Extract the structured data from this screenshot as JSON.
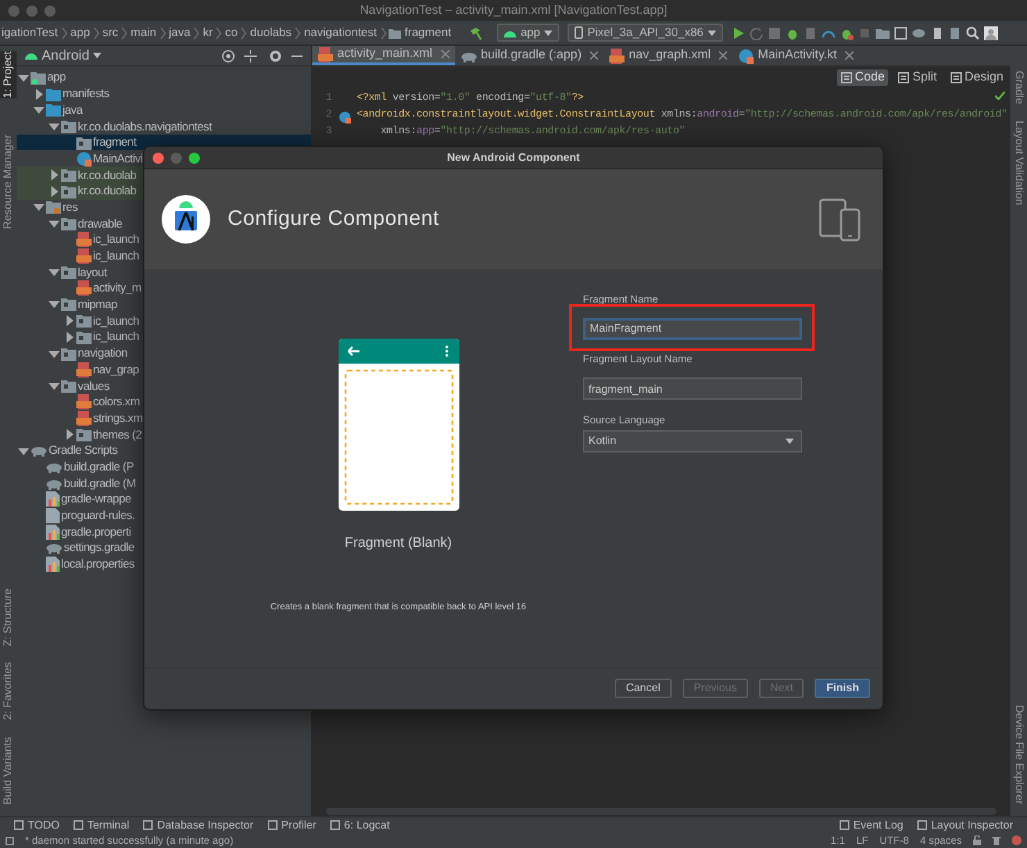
{
  "window": {
    "title": "NavigationTest – activity_main.xml [NavigationTest.app]"
  },
  "breadcrumbs": [
    "igationTest",
    "app",
    "src",
    "main",
    "java",
    "kr",
    "co",
    "duolabs",
    "navigationtest",
    "fragment"
  ],
  "run_config": "app",
  "device": "Pixel_3a_API_30_x86",
  "left_strip": {
    "top": [
      {
        "label": "1: Project",
        "selected": true
      },
      {
        "label": "Resource Manager",
        "selected": false
      }
    ],
    "bottom": [
      {
        "label": "Z: Structure",
        "selected": false
      },
      {
        "label": "2: Favorites",
        "selected": false
      },
      {
        "label": "Build Variants",
        "selected": false
      }
    ]
  },
  "project_panel": {
    "view": "Android",
    "tree": [
      {
        "label": "app",
        "kind": "module",
        "expanded": true,
        "selected": false,
        "children": [
          {
            "label": "manifests",
            "kind": "folder",
            "expanded": false,
            "selected": false
          },
          {
            "label": "java",
            "kind": "folder",
            "expanded": true,
            "selected": false,
            "children": [
              {
                "label": "kr.co.duolabs.navigationtest",
                "kind": "package",
                "expanded": true,
                "selected": false,
                "children": [
                  {
                    "label": "fragment",
                    "kind": "package",
                    "selected": true
                  },
                  {
                    "label": "MainActivi",
                    "kind": "kotlin",
                    "selected": false
                  }
                ]
              },
              {
                "label": "kr.co.duolab",
                "kind": "test_package",
                "expanded": false,
                "selected": false
              },
              {
                "label": "kr.co.duolab",
                "kind": "test_package",
                "expanded": false,
                "selected": false
              }
            ]
          },
          {
            "label": "res",
            "kind": "res_folder",
            "expanded": true,
            "selected": false,
            "children": [
              {
                "label": "drawable",
                "kind": "package",
                "expanded": true,
                "selected": false,
                "children": [
                  {
                    "label": "ic_launch",
                    "kind": "xml",
                    "selected": false
                  },
                  {
                    "label": "ic_launch",
                    "kind": "xml",
                    "selected": false
                  }
                ]
              },
              {
                "label": "layout",
                "kind": "package",
                "expanded": true,
                "selected": false,
                "children": [
                  {
                    "label": "activity_m",
                    "kind": "xml",
                    "selected": false
                  }
                ]
              },
              {
                "label": "mipmap",
                "kind": "package",
                "expanded": true,
                "selected": false,
                "children": [
                  {
                    "label": "ic_launch",
                    "kind": "package",
                    "expanded": false,
                    "selected": false
                  },
                  {
                    "label": "ic_launch",
                    "kind": "package",
                    "expanded": false,
                    "selected": false
                  }
                ]
              },
              {
                "label": "navigation",
                "kind": "package",
                "expanded": true,
                "selected": false,
                "children": [
                  {
                    "label": "nav_grap",
                    "kind": "xml",
                    "selected": false
                  }
                ]
              },
              {
                "label": "values",
                "kind": "package",
                "expanded": true,
                "selected": false,
                "children": [
                  {
                    "label": "colors.xm",
                    "kind": "xml",
                    "selected": false
                  },
                  {
                    "label": "strings.xm",
                    "kind": "xml",
                    "selected": false
                  },
                  {
                    "label": "themes (2",
                    "kind": "package",
                    "expanded": false,
                    "selected": false
                  }
                ]
              }
            ]
          }
        ]
      },
      {
        "label": "Gradle Scripts",
        "kind": "gradle",
        "expanded": true,
        "selected": false,
        "children": [
          {
            "label": "build.gradle (P",
            "kind": "gradle",
            "selected": false
          },
          {
            "label": "build.gradle (M",
            "kind": "gradle",
            "selected": false
          },
          {
            "label": "gradle-wrappe",
            "kind": "properties",
            "selected": false
          },
          {
            "label": "proguard-rules.",
            "kind": "file",
            "selected": false
          },
          {
            "label": "gradle.properti",
            "kind": "properties",
            "selected": false
          },
          {
            "label": "settings.gradle",
            "kind": "gradle",
            "selected": false
          },
          {
            "label": "local.properties",
            "kind": "properties",
            "selected": false
          }
        ]
      }
    ]
  },
  "editor": {
    "tabs": [
      {
        "label": "activity_main.xml",
        "kind": "xml",
        "selected": true
      },
      {
        "label": "build.gradle (:app)",
        "kind": "gradle",
        "selected": false
      },
      {
        "label": "nav_graph.xml",
        "kind": "xml",
        "selected": false
      },
      {
        "label": "MainActivity.kt",
        "kind": "kotlin",
        "selected": false
      }
    ],
    "view_modes": [
      {
        "label": "Code",
        "selected": true
      },
      {
        "label": "Split",
        "selected": false
      },
      {
        "label": "Design",
        "selected": false
      }
    ],
    "lines": [
      {
        "number": "1",
        "tokens": [
          {
            "kind": "tag",
            "text": "<?xml "
          },
          {
            "kind": "plain",
            "text": "version="
          },
          {
            "kind": "value",
            "text": "\"1.0\""
          },
          {
            "kind": "plain",
            "text": " encoding="
          },
          {
            "kind": "value",
            "text": "\"utf-8\""
          },
          {
            "kind": "tag",
            "text": "?>"
          }
        ]
      },
      {
        "number": "2",
        "tokens": [
          {
            "kind": "tag",
            "text": "<androidx.constraintlayout.widget.ConstraintLayout "
          },
          {
            "kind": "plain",
            "text": "xmlns:"
          },
          {
            "kind": "ns",
            "text": "android"
          },
          {
            "kind": "plain",
            "text": "="
          },
          {
            "kind": "value",
            "text": "\"http://schemas.android.com/apk/res/android\""
          }
        ]
      },
      {
        "number": "3",
        "tokens": [
          {
            "kind": "plain",
            "text": "    xmlns:"
          },
          {
            "kind": "ns",
            "text": "app"
          },
          {
            "kind": "plain",
            "text": "="
          },
          {
            "kind": "value",
            "text": "\"http://schemas.android.com/apk/res-auto\""
          }
        ]
      }
    ]
  },
  "right_strip": {
    "top": [
      {
        "label": "Gradle"
      },
      {
        "label": "Layout Validation"
      }
    ],
    "bottom": [
      {
        "label": "Device File Explorer"
      }
    ]
  },
  "dialog": {
    "title": "New Android Component",
    "heading": "Configure Component",
    "template": {
      "name": "Fragment (Blank)",
      "description": "Creates a blank fragment that is compatible back to API level 16"
    },
    "fields": [
      {
        "label": "Fragment Name",
        "value": "MainFragment",
        "kind": "text",
        "focused": true,
        "highlighted": true
      },
      {
        "label": "Fragment Layout Name",
        "value": "fragment_main",
        "kind": "text",
        "focused": false,
        "highlighted": false
      },
      {
        "label": "Source Language",
        "value": "Kotlin",
        "kind": "dropdown",
        "focused": false,
        "highlighted": false
      }
    ],
    "buttons": [
      {
        "label": "Cancel",
        "kind": "default",
        "disabled": false
      },
      {
        "label": "Previous",
        "kind": "default",
        "disabled": true
      },
      {
        "label": "Next",
        "kind": "default",
        "disabled": true
      },
      {
        "label": "Finish",
        "kind": "primary",
        "disabled": false
      }
    ]
  },
  "tool_windows": {
    "left": [
      "TODO",
      "Terminal",
      "Database Inspector",
      "Profiler",
      "6: Logcat"
    ],
    "right": [
      "Event Log",
      "Layout Inspector"
    ]
  },
  "status_bar": {
    "message": "* daemon started successfully (a minute ago)",
    "items": [
      "1:1",
      "LF",
      "UTF-8",
      "4 spaces"
    ]
  }
}
